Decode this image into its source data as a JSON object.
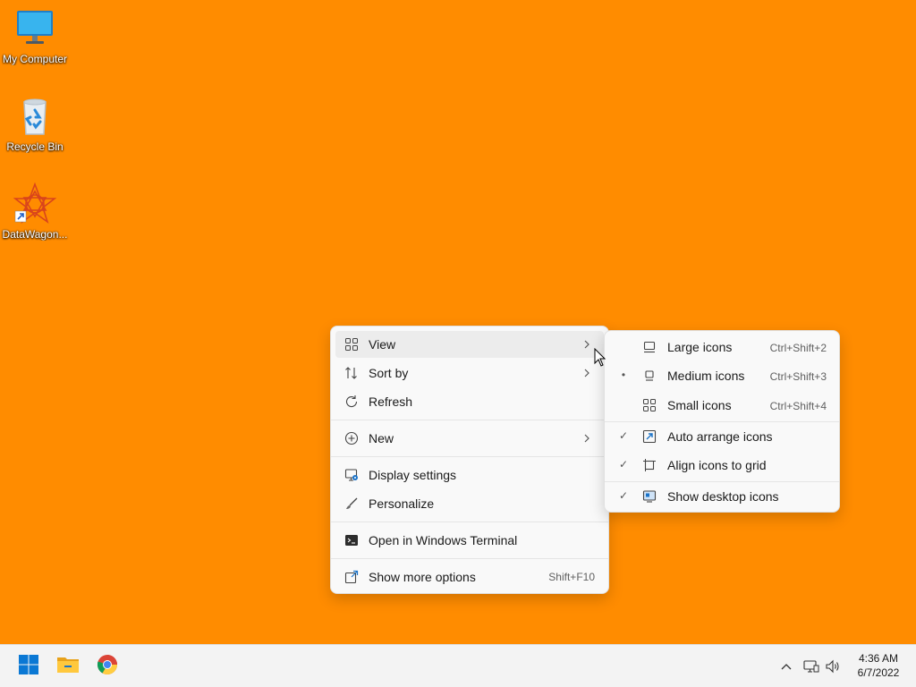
{
  "desktop": {
    "background": "#ff8c00",
    "icons": [
      {
        "label": "My Computer",
        "icon": "monitor-icon"
      },
      {
        "label": "Recycle Bin",
        "icon": "recycle-bin-icon"
      },
      {
        "label": "DataWagon...",
        "icon": "datawagon-app-icon"
      }
    ]
  },
  "context_menu": {
    "items": [
      {
        "label": "View",
        "icon": "grid-icon",
        "submenu": true
      },
      {
        "label": "Sort by",
        "icon": "sort-icon",
        "submenu": true
      },
      {
        "label": "Refresh",
        "icon": "refresh-icon"
      },
      {
        "label": "New",
        "icon": "plus-circle-icon",
        "submenu": true
      },
      {
        "label": "Display settings",
        "icon": "display-settings-icon"
      },
      {
        "label": "Personalize",
        "icon": "brush-icon"
      },
      {
        "label": "Open in Windows Terminal",
        "icon": "terminal-icon"
      },
      {
        "label": "Show more options",
        "icon": "share-icon",
        "shortcut": "Shift+F10"
      }
    ]
  },
  "view_submenu": {
    "items": [
      {
        "label": "Large icons",
        "icon": "large-icons-icon",
        "shortcut": "Ctrl+Shift+2",
        "mark": ""
      },
      {
        "label": "Medium icons",
        "icon": "medium-icons-icon",
        "shortcut": "Ctrl+Shift+3",
        "mark": "•"
      },
      {
        "label": "Small icons",
        "icon": "small-icons-icon",
        "shortcut": "Ctrl+Shift+4",
        "mark": ""
      },
      {
        "label": "Auto arrange icons",
        "icon": "auto-arrange-icon",
        "mark": "✓"
      },
      {
        "label": "Align icons to grid",
        "icon": "align-grid-icon",
        "mark": "✓"
      },
      {
        "label": "Show desktop icons",
        "icon": "show-desktop-icon",
        "mark": "✓"
      }
    ]
  },
  "taskbar": {
    "apps": [
      {
        "name": "Start",
        "icon": "windows-start-icon"
      },
      {
        "name": "File Explorer",
        "icon": "folder-icon"
      },
      {
        "name": "Google Chrome",
        "icon": "chrome-icon"
      }
    ],
    "tray": [
      "chevron-up-icon",
      "network-icon",
      "volume-icon"
    ],
    "clock": {
      "time": "4:36 AM",
      "date": "6/7/2022"
    }
  }
}
